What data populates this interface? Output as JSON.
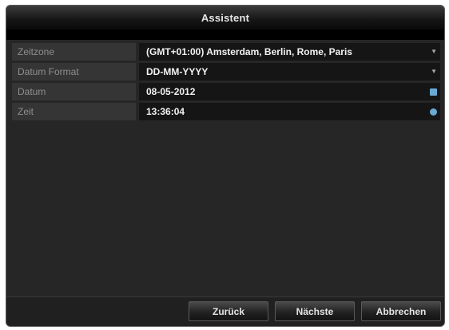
{
  "window": {
    "title": "Assistent"
  },
  "form": {
    "rows": [
      {
        "label": "Zeitzone",
        "value": "(GMT+01:00) Amsterdam, Berlin, Rome, Paris",
        "control": "dropdown-caret-icon"
      },
      {
        "label": "Datum Format",
        "value": "DD-MM-YYYY",
        "control": "dropdown-caret-icon"
      },
      {
        "label": "Datum",
        "value": "08-05-2012",
        "control": "calendar-icon"
      },
      {
        "label": "Zeit",
        "value": "13:36:04",
        "control": "clock-icon"
      }
    ]
  },
  "footer": {
    "back_label": "Zurück",
    "next_label": "Nächste",
    "cancel_label": "Abbrechen"
  },
  "colors": {
    "accent": "#6aa9d6",
    "panel": "#262626",
    "field": "#151515",
    "label_bg": "#353535"
  }
}
